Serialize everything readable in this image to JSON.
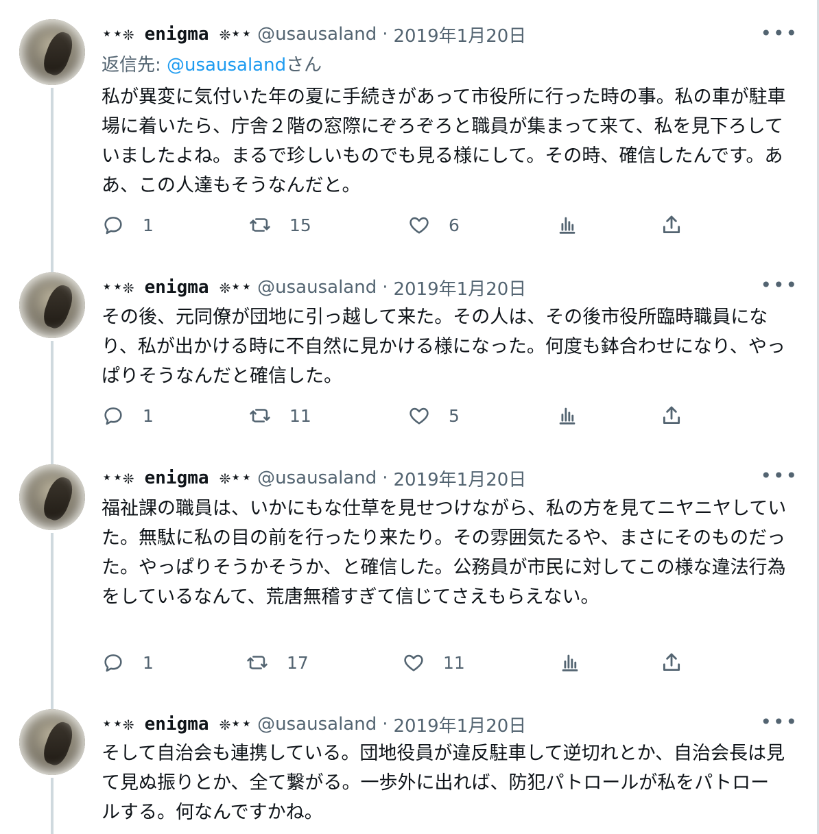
{
  "tweets": [
    {
      "name": "⋆⋆❊ enigma ❊⋆⋆",
      "handle": "@usausaland",
      "separator": "·",
      "date": "2019年1月20日",
      "reply_label": "返信先: ",
      "reply_mention": "@usausaland",
      "reply_suffix": "さん",
      "text": "私が異変に気付いた年の夏に手続きがあって市役所に行った時の事。私の車が駐車場に着いたら、庁舎２階の窓際にぞろぞろと職員が集まって来て、私を見下ろしていましたよね。まるで珍しいものでも見る様にして。その時、確信したんです。ああ、この人達もそうなんだと。",
      "replies": "1",
      "retweets": "15",
      "likes": "6"
    },
    {
      "name": "⋆⋆❊ enigma ❊⋆⋆",
      "handle": "@usausaland",
      "separator": "·",
      "date": "2019年1月20日",
      "text": "その後、元同僚が団地に引っ越して来た。その人は、その後市役所臨時職員になり、私が出かける時に不自然に見かける様になった。何度も鉢合わせになり、やっぱりそうなんだと確信した。",
      "replies": "1",
      "retweets": "11",
      "likes": "5"
    },
    {
      "name": "⋆⋆❊ enigma ❊⋆⋆",
      "handle": "@usausaland",
      "separator": "·",
      "date": "2019年1月20日",
      "text": "福祉課の職員は、いかにもな仕草を見せつけながら、私の方を見てニヤニヤしていた。無駄に私の目の前を行ったり来たり。その雰囲気たるや、まさにそのものだった。やっぱりそうかそうか、と確信した。公務員が市民に対してこの様な違法行為をしているなんて、荒唐無稽すぎて信じてさえもらえない。",
      "replies": "1",
      "retweets": "17",
      "likes": "11"
    },
    {
      "name": "⋆⋆❊ enigma ❊⋆⋆",
      "handle": "@usausaland",
      "separator": "·",
      "date": "2019年1月20日",
      "text": "そして自治会も連携している。団地役員が違反駐車して逆切れとか、自治会長は見て見ぬ振りとか、全て繋がる。一歩外に出れば、防犯パトロールが私をパトロールする。何なんですかね。"
    }
  ],
  "icons": {
    "more": "more-icon",
    "reply": "reply-icon",
    "retweet": "retweet-icon",
    "like": "like-icon",
    "analytics": "analytics-icon",
    "share": "share-icon"
  },
  "colors": {
    "text": "#0f1419",
    "secondary": "#536471",
    "link": "#1d9bf0",
    "thread_line": "#cfd9de"
  }
}
